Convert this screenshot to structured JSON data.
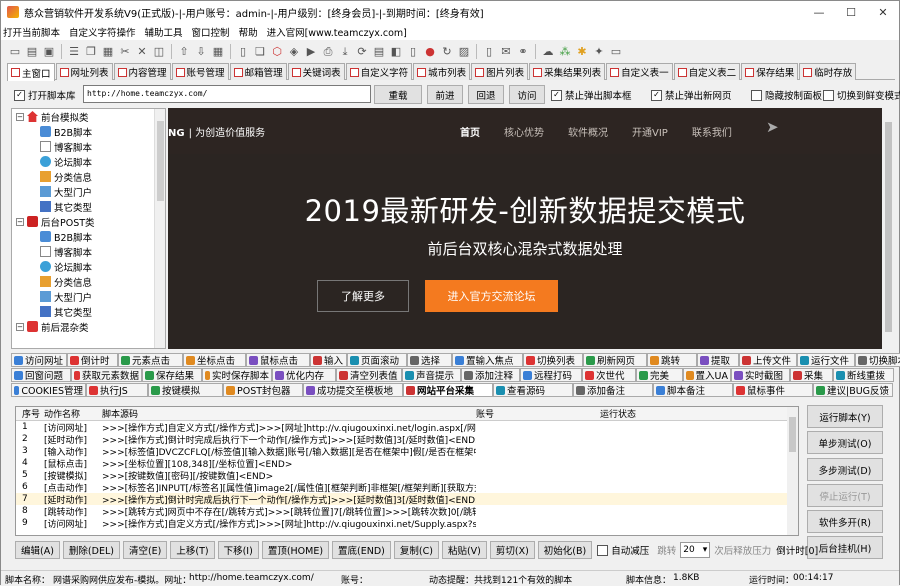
{
  "window": {
    "title": "慈众营销软件开发系统V9(正式版)-|-用户账号：admin-|-用户级别：[终身会员]-|-到期时间：[终身有效]"
  },
  "menu": [
    "打开当前脚本",
    "自定义字符操作",
    "辅助工具",
    "窗口控制",
    "帮助",
    "进入官网[www.teamczyx.com]"
  ],
  "tabs": [
    "主窗口",
    "网址列表",
    "内容管理",
    "账号管理",
    "邮箱管理",
    "关键词表",
    "自定义字符",
    "城市列表",
    "图片列表",
    "采集结果列表",
    "自定义表一",
    "自定义表二",
    "保存结果",
    "临时存放"
  ],
  "nav": {
    "open_script_label": "打开脚本库",
    "url": "http://home.teamczyx.com/",
    "buttons": [
      "重载",
      "前进",
      "回退",
      "访问"
    ],
    "checks": [
      {
        "label": "禁止弹出脚本框",
        "checked": true
      },
      {
        "label": "禁止弹出新网页",
        "checked": true
      },
      {
        "label": "隐藏按制面板",
        "checked": false
      },
      {
        "label": "切换到鲜变模式(K)",
        "checked": false
      }
    ]
  },
  "tree": [
    {
      "level": 0,
      "label": "前台模拟类",
      "icon": "house"
    },
    {
      "level": 1,
      "label": "B2B脚本",
      "icon": "b2b"
    },
    {
      "level": 1,
      "label": "博客脚本",
      "icon": "doc"
    },
    {
      "level": 1,
      "label": "论坛脚本",
      "icon": "forum"
    },
    {
      "level": 1,
      "label": "分类信息",
      "icon": "category"
    },
    {
      "level": 1,
      "label": "大型门户",
      "icon": "portal"
    },
    {
      "level": 1,
      "label": "其它类型",
      "icon": "other"
    },
    {
      "level": 0,
      "label": "后台POST类",
      "icon": "post"
    },
    {
      "level": 1,
      "label": "B2B脚本",
      "icon": "b2b"
    },
    {
      "level": 1,
      "label": "博客脚本",
      "icon": "doc"
    },
    {
      "level": 1,
      "label": "论坛脚本",
      "icon": "forum"
    },
    {
      "level": 1,
      "label": "分类信息",
      "icon": "category"
    },
    {
      "level": 1,
      "label": "大型门户",
      "icon": "portal"
    },
    {
      "level": 1,
      "label": "其它类型",
      "icon": "other"
    },
    {
      "level": 0,
      "label": "前后混杂类",
      "icon": "mixed"
    }
  ],
  "web": {
    "brand_mark": "NG",
    "brand": "为创造价值服务",
    "menu": [
      "首页",
      "核心优势",
      "软件概况",
      "开通VIP",
      "联系我们"
    ],
    "hero": "2019最新研发-创新数据提交模式",
    "sub": "前后台双核心混杂式数据处理",
    "btn_more": "了解更多",
    "btn_forum": "进入官方交流论坛"
  },
  "cmd_row1": [
    "访问网址",
    "倒计时",
    "元素点击",
    "坐标点击",
    "鼠标点击",
    "输入",
    "页面滚动",
    "选择",
    "置输入焦点",
    "切换列表",
    "刷新网页",
    "跳转",
    "提取",
    "上传文件",
    "运行文件",
    "切换脚本"
  ],
  "cmd_row2": [
    "回窗问题",
    "获取元素数据",
    "保存结果",
    "实时保存脚本",
    "优化内存",
    "清空列表值",
    "声音提示",
    "添加注释",
    "远程打码",
    "次世代",
    "完美",
    "置入UA",
    "实时截图",
    "采集",
    "断线重拨"
  ],
  "cmd_row3": [
    "COOKIES管理",
    "执行JS",
    "按键模拟",
    "POST封包器",
    "成功提交至模板地",
    "网站平台采集",
    "查看源码",
    "添加备注",
    "脚本备注",
    "鼠标事件",
    "建议|BUG反馈"
  ],
  "grid": {
    "headers": [
      "序号",
      "动作名称",
      "脚本源码",
      "账号",
      "运行状态"
    ],
    "rows": [
      [
        "1",
        "[访问网址]",
        ">>>[操作方式]自定义方式[/操作方式]>>>[网址]http://v.qiugouxinxi.net/login.aspx[/网址]>>>[延..."
      ],
      [
        "2",
        "[延时动作]",
        ">>>[操作方式]倒计时完成后执行下一个动作[/操作方式]>>>[延时数值]3[/延时数值]<END>"
      ],
      [
        "3",
        "[输入动作]",
        ">>>[标签值]DVCZCFLQ[/标签值][输入数据]账号[/输入数据][是否在框架中]假[/是否在框架中][是否..."
      ],
      [
        "4",
        "[鼠标点击]",
        ">>>[坐标位置][108,348][/坐标位置]<END>"
      ],
      [
        "5",
        "[按键模拟]",
        ">>>[按键数值][密码][/按键数值]<END>"
      ],
      [
        "6",
        "[点击动作]",
        ">>>[标签名]INPUT[/标签名][属性值]image2[/属性值][框架判断]非框架[/框架判断][获取方式]固定数..."
      ],
      [
        "7",
        "[延时动作]",
        ">>>[操作方式]倒计时完成后执行下一个动作[/操作方式]>>>[延时数值]3[/延时数值]<END><目标>1"
      ],
      [
        "8",
        "[跳转动作]",
        ">>>[跳转方式]网页中不存在[/跳转方式]>>>[跳转位置]7[/跳转位置]>>>[跳转次数]0[/跳转次数..."
      ],
      [
        "9",
        "[访问网址]",
        ">>>[操作方式]自定义方式[/操作方式]>>>[网址]http://v.qiugouxinxi.net/Supply.aspx?spn=6369689..."
      ]
    ]
  },
  "right_buttons": [
    "运行脚本(Y)",
    "单步测试(O)",
    "多步测试(D)",
    "停止运行(T)",
    "软件多开(R)",
    "后台挂机(H)"
  ],
  "bottom": {
    "buttons": [
      "编辑(A)",
      "删除(DEL)",
      "清空(E)",
      "上移(T)",
      "下移(I)",
      "置顶(HOME)",
      "置底(END)",
      "复制(C)",
      "粘贴(V)",
      "剪切(X)",
      "初始化(B)"
    ],
    "auto_label": "自动减压",
    "jump_label": "跳转",
    "jump_value": "20",
    "pressure_label": "次后释放压力",
    "countdown": "倒计时[0]"
  },
  "status": {
    "script_label": "脚本名称：",
    "script_name": "网谱采购网供应发布-模拟。网址：",
    "url": "http://home.teamczyx.com/",
    "account_label": "账号：",
    "hint_label": "动态提醒：",
    "hint": "共找到121个有效的脚本",
    "info_label": "脚本信息：",
    "info": "1.8KB",
    "time_label": "运行时间：",
    "time": "00:14:17"
  },
  "colors": {
    "accent": "#f47a1f",
    "web_bg": "#2b2522"
  }
}
